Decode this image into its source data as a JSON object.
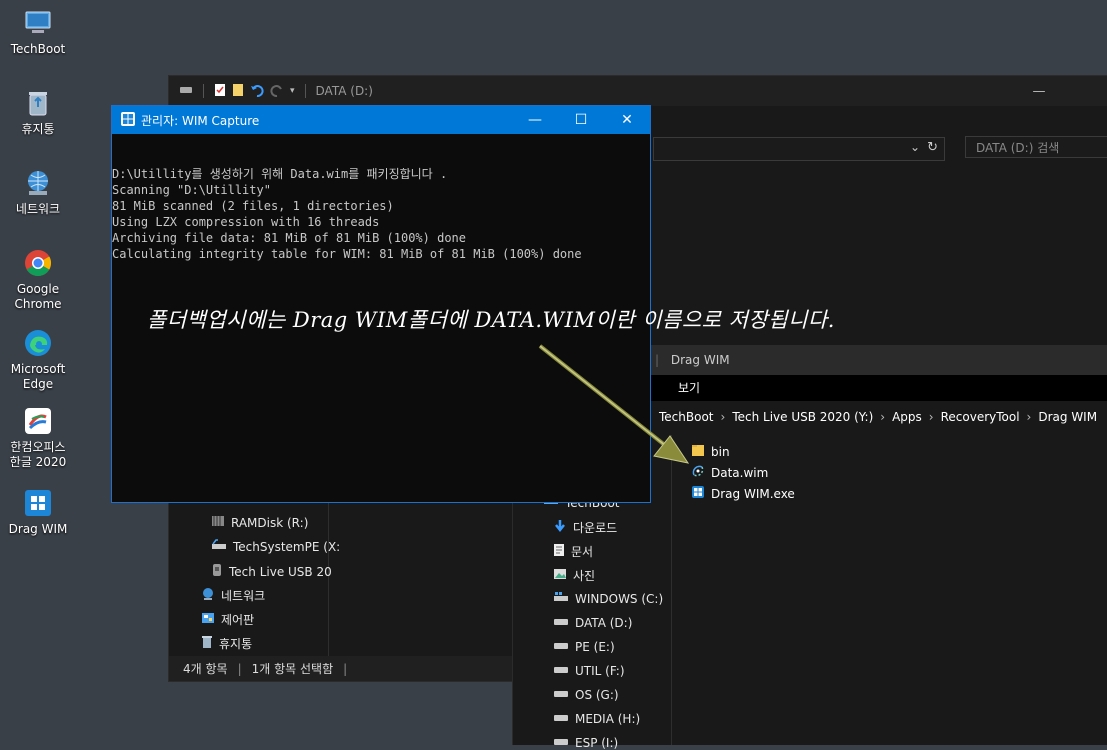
{
  "desktop": {
    "icons": [
      {
        "label": "TechBoot",
        "icon": "computer-icon"
      },
      {
        "label": "휴지통",
        "icon": "recycle-bin-icon"
      },
      {
        "label": "네트워크",
        "icon": "network-icon"
      },
      {
        "label": "Google\nChrome",
        "icon": "chrome-icon"
      },
      {
        "label": "Microsoft\nEdge",
        "icon": "edge-icon"
      },
      {
        "label": "한컴오피스\n한글 2020",
        "icon": "hancom-icon"
      },
      {
        "label": "Drag WIM",
        "icon": "drag-wim-icon"
      }
    ]
  },
  "explorer_data": {
    "title": "DATA (D:)",
    "search_placeholder": "DATA (D:) 검색",
    "nav_items": [
      {
        "label": "RAMDisk (R:)",
        "icon": "ramdisk-icon"
      },
      {
        "label": "TechSystemPE (X:",
        "icon": "drive-icon"
      },
      {
        "label": "Tech Live USB 20",
        "icon": "usb-drive-icon"
      },
      {
        "label": "네트워크",
        "icon": "network-icon"
      },
      {
        "label": "제어판",
        "icon": "control-panel-icon"
      },
      {
        "label": "휴지통",
        "icon": "recycle-bin-icon"
      }
    ],
    "status_items": "4개 항목",
    "status_selected": "1개 항목 선택함"
  },
  "explorer_dragwim": {
    "title": "Drag WIM",
    "menu_view": "보기",
    "breadcrumb": [
      "TechBoot",
      "Tech Live USB 2020 (Y:)",
      "Apps",
      "RecoveryTool",
      "Drag WIM"
    ],
    "files": [
      {
        "name": "bin",
        "icon": "folder-icon"
      },
      {
        "name": "Data.wim",
        "icon": "wim-file-icon"
      },
      {
        "name": "Drag WIM.exe",
        "icon": "app-exe-icon"
      }
    ],
    "nav_items": [
      {
        "label": "TechBoot",
        "icon": "computer-icon"
      },
      {
        "label": "다운로드",
        "icon": "download-icon"
      },
      {
        "label": "문서",
        "icon": "document-icon"
      },
      {
        "label": "사진",
        "icon": "picture-icon"
      },
      {
        "label": "WINDOWS (C:)",
        "icon": "windows-drive-icon"
      },
      {
        "label": "DATA (D:)",
        "icon": "drive-icon"
      },
      {
        "label": "PE (E:)",
        "icon": "drive-icon"
      },
      {
        "label": "UTIL (F:)",
        "icon": "drive-icon"
      },
      {
        "label": "OS (G:)",
        "icon": "drive-icon"
      },
      {
        "label": "MEDIA (H:)",
        "icon": "drive-icon"
      },
      {
        "label": "ESP (I:)",
        "icon": "drive-icon"
      }
    ]
  },
  "console": {
    "title": "관리자:  WIM Capture",
    "lines": [
      "D:\\Utillity를 생성하기 위해 Data.wim를 패키징합니다 .",
      "Scanning \"D:\\Utillity\"",
      "81 MiB scanned (2 files, 1 directories)",
      "Using LZX compression with 16 threads",
      "Archiving file data: 81 MiB of 81 MiB (100%) done",
      "Calculating integrity table for WIM: 81 MiB of 81 MiB (100%) done"
    ]
  },
  "annotation": {
    "text": "폴더백업시에는 Drag WIM폴더에 DATA.WIM이란 이름으로 저장됩니다.",
    "arrow_color": "#8a8c3c"
  },
  "colors": {
    "accent": "#0078d7",
    "desktop_bg": "#3a4048",
    "window_bg": "#191919"
  }
}
